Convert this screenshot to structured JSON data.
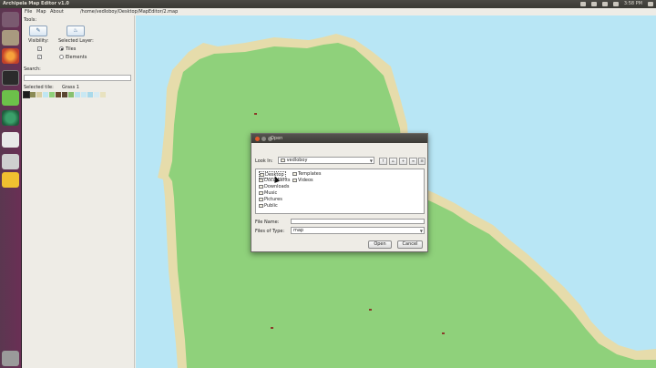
{
  "topbar": {
    "title": "Archipela Map Editor v1.0",
    "time": "3:58 PM"
  },
  "menubar": {
    "items": [
      "File",
      "Map",
      "About"
    ],
    "path": "/home/vedloboy/Desktop/MapEditor/2.map"
  },
  "tools": {
    "tools_label": "Tools:",
    "visibility_label": "Visibility:",
    "selected_layer_label": "Selected Layer:",
    "tiles_label": "Tiles",
    "elements_label": "Elements",
    "search_label": "Search:",
    "selected_tile_label": "Selected tile:",
    "selected_tile_value": "Grass 1",
    "visibility_tiles_checked": true,
    "visibility_elements_checked": true,
    "selected_layer": "Tiles",
    "swatches": [
      "#1d1d1d",
      "#8b8b55",
      "#d9cfa3",
      "#bfe6f2",
      "#8fd17b",
      "#6a4b2e",
      "#5a4632",
      "#88c06e",
      "#b9e1ef",
      "#c9e8f3",
      "#a9d9ea",
      "#d7ebf3",
      "#e8e2c0"
    ]
  },
  "dialog": {
    "title": "Open",
    "look_in_label": "Look In:",
    "look_in_value": "vedloboy",
    "files": [
      "Desktop",
      "Templates",
      "Documents",
      "Videos",
      "Downloads",
      "Music",
      "Pictures",
      "Public"
    ],
    "file_name_label": "File Name:",
    "file_name_value": "",
    "files_of_type_label": "Files of Type:",
    "files_of_type_value": "map",
    "open_label": "Open",
    "cancel_label": "Cancel"
  },
  "colors": {
    "water": "#b8e6f5",
    "sand": "#e6dcab",
    "grass": "#8fd17b",
    "accent_close": "#e05a2b"
  }
}
